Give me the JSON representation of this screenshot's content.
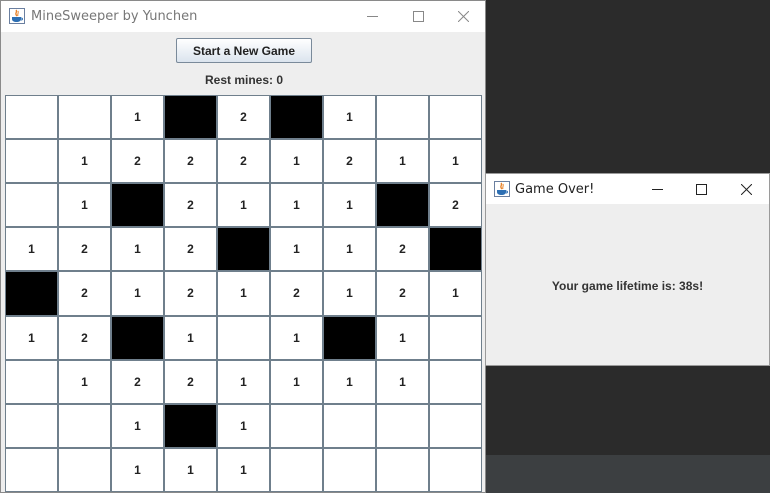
{
  "main_window": {
    "title": "MineSweeper by Yunchen",
    "new_game_label": "Start a New Game",
    "rest_mines_label": "Rest mines: 0"
  },
  "board": {
    "rows": 9,
    "cols": 9,
    "cells": [
      [
        "",
        "",
        "1",
        "#",
        "2",
        "#",
        "1",
        "",
        ""
      ],
      [
        "",
        "1",
        "2",
        "2",
        "2",
        "1",
        "2",
        "1",
        "1"
      ],
      [
        "",
        "1",
        "#",
        "2",
        "1",
        "1",
        "1",
        "#",
        "2"
      ],
      [
        "1",
        "2",
        "1",
        "2",
        "#",
        "1",
        "1",
        "2",
        "#"
      ],
      [
        "#",
        "2",
        "1",
        "2",
        "1",
        "2",
        "1",
        "2",
        "1"
      ],
      [
        "1",
        "2",
        "#",
        "1",
        "",
        "1",
        "#",
        "1",
        ""
      ],
      [
        "",
        "1",
        "2",
        "2",
        "1",
        "1",
        "1",
        "1",
        ""
      ],
      [
        "",
        "",
        "1",
        "#",
        "1",
        "",
        "",
        "",
        ""
      ],
      [
        "",
        "",
        "1",
        "1",
        "1",
        "",
        "",
        "",
        ""
      ]
    ],
    "mine_color": "#000000",
    "revealed_color": "#ffffff"
  },
  "dialog": {
    "title": "Game Over!",
    "message": "Your game lifetime is: 38s!"
  },
  "icons": {
    "app": "java-cup-icon",
    "minimize": "minimize-icon",
    "maximize": "maximize-icon",
    "close": "close-icon"
  }
}
